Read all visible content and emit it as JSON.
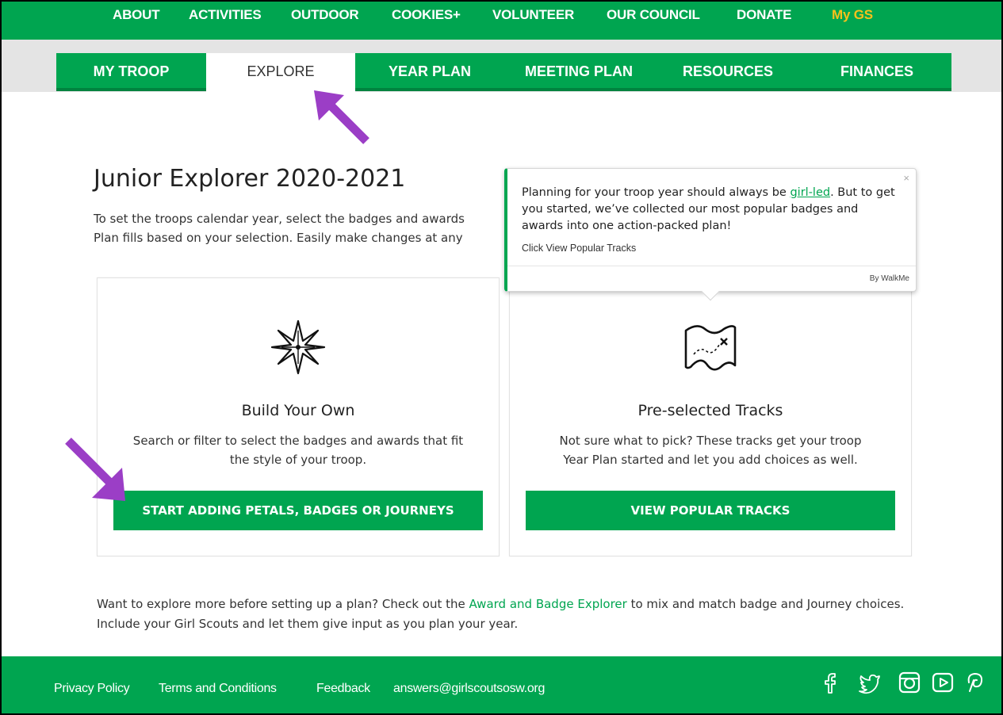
{
  "topnav": {
    "items": [
      "ABOUT",
      "ACTIVITIES",
      "OUTDOOR",
      "COOKIES+",
      "VOLUNTEER",
      "OUR COUNCIL",
      "DONATE"
    ],
    "account": "My GS"
  },
  "tabs": [
    {
      "label": "MY TROOP"
    },
    {
      "label": "EXPLORE"
    },
    {
      "label": "YEAR PLAN"
    },
    {
      "label": "MEETING PLAN"
    },
    {
      "label": "RESOURCES"
    },
    {
      "label": "FINANCES"
    }
  ],
  "page": {
    "title": "Junior Explorer 2020-2021",
    "intro": "To set the troops calendar year, select the badges and awards\nPlan fills based on your selection. Easily make changes at any"
  },
  "cards": [
    {
      "title": "Build Your Own",
      "description": "Search or filter to select the badges and awards that fit\nthe style of your troop.",
      "button": "START ADDING PETALS, BADGES OR JOURNEYS",
      "icon": "compass-star-icon"
    },
    {
      "title": "Pre-selected Tracks",
      "description": "Not sure what to pick? These tracks get your troop\nYear Plan started and let you add choices as well.",
      "button": "VIEW POPULAR TRACKS",
      "icon": "treasure-map-icon"
    }
  ],
  "tooltip": {
    "text_before": "Planning for your troop year should always be ",
    "link": "girl-led",
    "text_after": ". But to get you started, we’ve collected our most popular badges and awards into one action-packed plan!",
    "hint": "Click View Popular Tracks",
    "byline": "By WalkMe",
    "close": "×"
  },
  "explore": {
    "before": "Want to explore more before setting up a plan? Check out the ",
    "link": "Award and Badge Explorer",
    "after": " to mix and match badge and Journey choices. Include your Girl Scouts and let them give input as you plan your year."
  },
  "footer": {
    "links": [
      "Privacy Policy",
      "Terms and Conditions",
      "Feedback",
      "answers@girlscoutsosw.org"
    ],
    "social": [
      "facebook-icon",
      "twitter-icon",
      "instagram-icon",
      "youtube-icon",
      "pinterest-icon"
    ]
  },
  "colors": {
    "brand_green": "#00a550",
    "account_gold": "#f7c11b",
    "annotation_purple": "#9b3ec6"
  }
}
